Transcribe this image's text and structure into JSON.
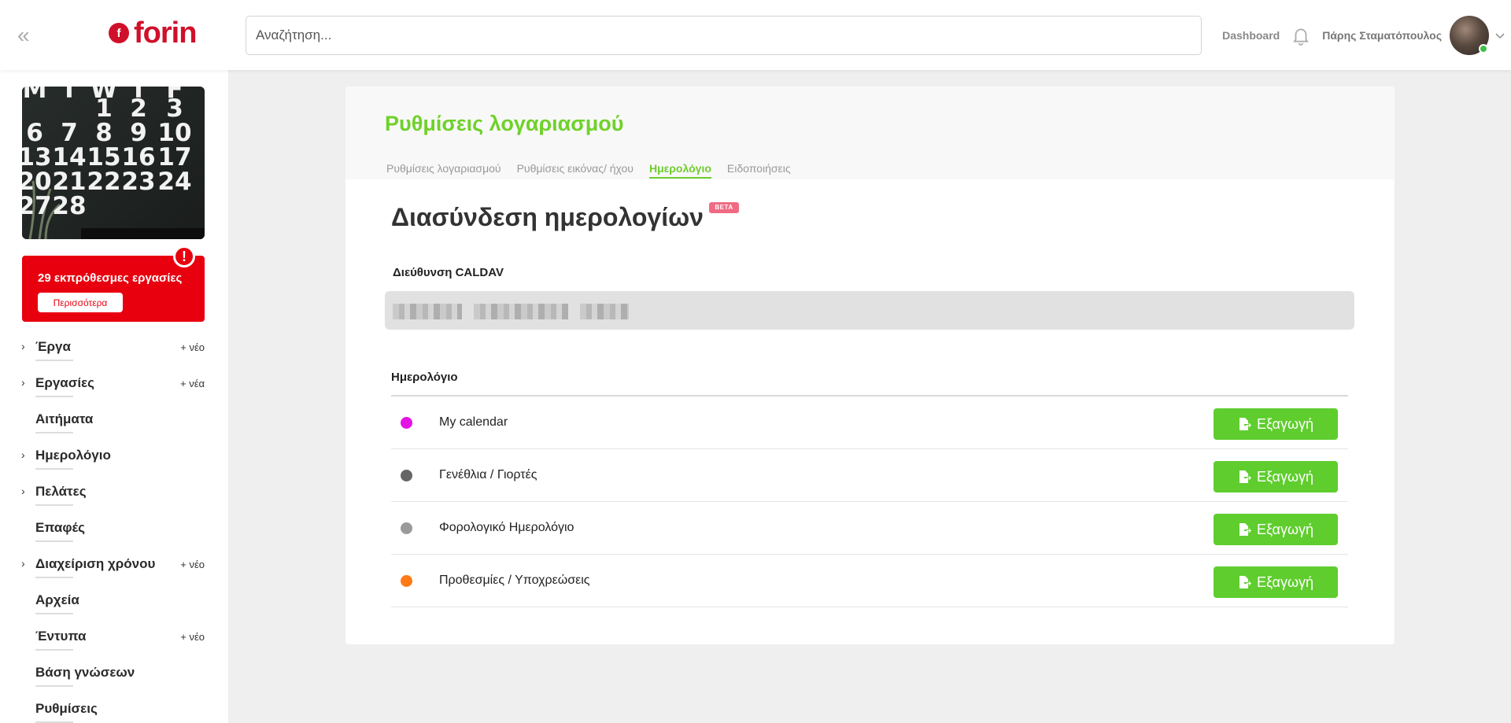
{
  "header": {
    "logo_text": "forin",
    "logo_mark": "f",
    "search_placeholder": "Αναζήτηση...",
    "dashboard_label": "Dashboard",
    "user_name": "Πάρης Σταματόπουλος"
  },
  "sidebar": {
    "calendar_image_numbers": {
      "weekdays": [
        "M",
        "T",
        "W",
        "T",
        "F"
      ],
      "rows": [
        [
          "",
          "",
          "1",
          "2",
          "3"
        ],
        [
          "6",
          "7",
          "8",
          "9",
          "10"
        ],
        [
          "13",
          "14",
          "15",
          "16",
          "17"
        ],
        [
          "20",
          "21",
          "22",
          "23",
          "24"
        ],
        [
          "27",
          "28",
          "",
          "",
          ""
        ]
      ]
    },
    "alert": {
      "text": "29 εκπρόθεσμες εργασίες",
      "button": "Περισσότερα",
      "badge": "!"
    },
    "items": [
      {
        "label": "Έργα",
        "chevron": true,
        "new": "+ νέο"
      },
      {
        "label": "Εργασίες",
        "chevron": true,
        "new": "+ νέα"
      },
      {
        "label": "Αιτήματα",
        "chevron": false,
        "new": ""
      },
      {
        "label": "Ημερολόγιο",
        "chevron": true,
        "new": ""
      },
      {
        "label": "Πελάτες",
        "chevron": true,
        "new": ""
      },
      {
        "label": "Επαφές",
        "chevron": false,
        "new": ""
      },
      {
        "label": "Διαχείριση χρόνου",
        "chevron": true,
        "new": "+ νέο"
      },
      {
        "label": "Αρχεία",
        "chevron": false,
        "new": ""
      },
      {
        "label": "Έντυπα",
        "chevron": false,
        "new": "+ νέο"
      },
      {
        "label": "Βάση γνώσεων",
        "chevron": false,
        "new": ""
      },
      {
        "label": "Ρυθμίσεις",
        "chevron": false,
        "new": ""
      }
    ]
  },
  "main": {
    "title": "Ρυθμίσεις λογαριασμού",
    "tabs": [
      {
        "label": "Ρυθμίσεις λογαριασμού",
        "active": false
      },
      {
        "label": "Ρυθμίσεις εικόνας/ ήχου",
        "active": false
      },
      {
        "label": "Ημερολόγιο",
        "active": true
      },
      {
        "label": "Ειδοποιήσεις",
        "active": false
      }
    ],
    "section_title": "Διασύνδεση ημερολογίων",
    "beta_label": "BETA",
    "caldav_label": "Διεύθυνση CALDAV",
    "calendar_heading": "Ημερολόγιο",
    "export_label": "Εξαγωγή",
    "calendars": [
      {
        "name": "My calendar",
        "color": "#e512e5"
      },
      {
        "name": "Γενέθλια / Γιορτές",
        "color": "#666666"
      },
      {
        "name": "Φορολογικό Ημερολόγιο",
        "color": "#9a9a9a"
      },
      {
        "name": "Προθεσμίες / Υποχρεώσεις",
        "color": "#ff7a14"
      }
    ]
  },
  "colors": {
    "brand_red": "#d0102a",
    "accent_green": "#6fd12a",
    "button_green": "#5fcd2e",
    "alert_red": "#e8000f"
  }
}
